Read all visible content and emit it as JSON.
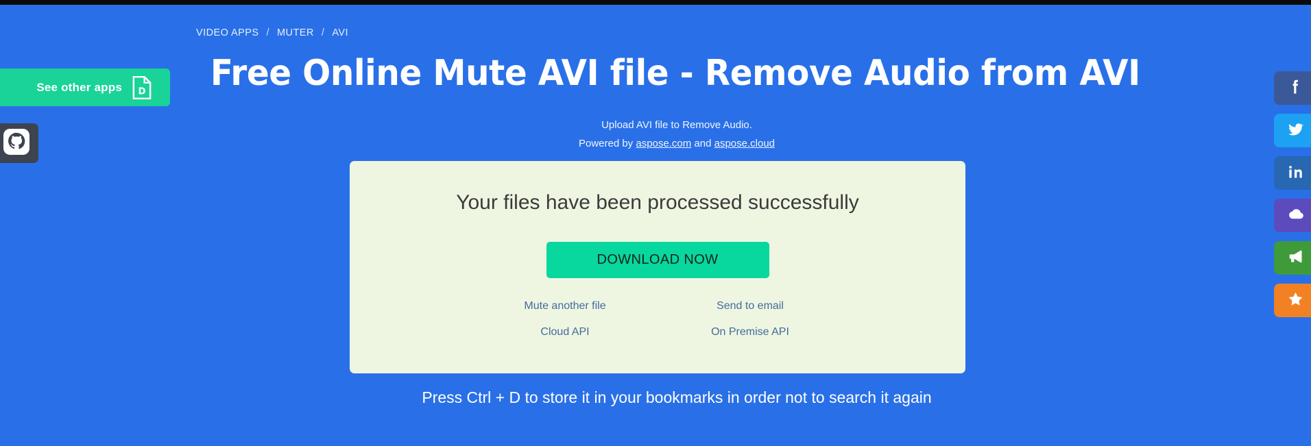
{
  "theme": {
    "background": "#2970e8",
    "accent_green": "#08d79e",
    "card_background": "#eef6e2",
    "link_color": "#436b9c",
    "top_strip": "#0a0a0a"
  },
  "left_rail": {
    "see_other_apps": {
      "label": "See other apps",
      "icon": "document-d-icon"
    },
    "github": {
      "icon": "github-icon"
    }
  },
  "breadcrumb": {
    "items": [
      {
        "label": "VIDEO APPS"
      },
      {
        "label": "MUTER"
      },
      {
        "label": "AVI"
      }
    ],
    "separator": "/"
  },
  "hero": {
    "title": "Free Online Mute AVI file - Remove Audio from AVI",
    "subtitle": "Upload AVI file to Remove Audio.",
    "powered_prefix": "Powered by ",
    "powered_link1": "aspose.com",
    "powered_middle": " and ",
    "powered_link2": "aspose.cloud"
  },
  "card": {
    "heading": "Your files have been processed successfully",
    "download_label": "DOWNLOAD NOW",
    "links": [
      {
        "label": "Mute another file"
      },
      {
        "label": "Send to email"
      },
      {
        "label": "Cloud API"
      },
      {
        "label": "On Premise API"
      }
    ]
  },
  "bottom_note": "Press Ctrl + D to store it in your bookmarks in order not to search it again",
  "social": [
    {
      "name": "facebook",
      "icon": "facebook-icon",
      "color": "#3b5998"
    },
    {
      "name": "twitter",
      "icon": "twitter-icon",
      "color": "#1da1f2"
    },
    {
      "name": "linkedin",
      "icon": "linkedin-icon",
      "color": "#2867b2"
    },
    {
      "name": "cloud",
      "icon": "cloud-icon",
      "color": "#5b4bbd"
    },
    {
      "name": "announce",
      "icon": "megaphone-icon",
      "color": "#3f9a3a"
    },
    {
      "name": "favorite",
      "icon": "star-icon",
      "color": "#f28123"
    }
  ]
}
